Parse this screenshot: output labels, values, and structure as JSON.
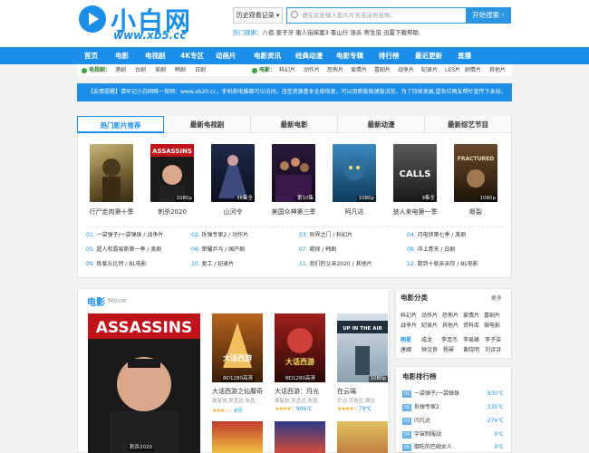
{
  "header": {
    "logo_text": "小白网",
    "logo_url": "www.xb5.cc",
    "history_label": "历史观看记录 ▾",
    "search_placeholder": "请在此处输入影片片名或演员名称。",
    "search_button": "开始搜索 ›",
    "hot_label": "热门搜索：",
    "hot_terms": "八佰  姜子牙  唐人街探案3  晋山行  误杀  寄生虫  迅雷下载帮助"
  },
  "nav": [
    "首页",
    "电影",
    "电视剧",
    "4K专区",
    "动画片",
    "电影资讯",
    "经典动漫",
    "电影专辑",
    "排行榜",
    "最近更新",
    "直播"
  ],
  "subcat": {
    "tv_label": "电视剧：",
    "tv_items": [
      "港剧",
      "台剧",
      "美剧",
      "韩剧",
      "日剧"
    ],
    "movie_label": "电影：",
    "movie_items": [
      "科幻片",
      "动作片",
      "恐怖片",
      "爱情片",
      "喜剧片",
      "战争片",
      "纪录片",
      "LES片",
      "剧情片",
      "其他片"
    ]
  },
  "notice": "【友情提醒】请牢记小白网唯一官网：www.xb20.cc，手机和电脑都可以访问。违签资源基本全部恢复，可以用新版极速版流览，为了持续发展,望各位网友帮忙宣传下本站。",
  "tabs": [
    "热门影片推荐",
    "最新电视剧",
    "最新电影",
    "最新动漫",
    "最新综艺节目"
  ],
  "hot_movies": [
    {
      "title": "行尸走肉第十季",
      "label": ""
    },
    {
      "title": "刺杀2020",
      "label": "1080p"
    },
    {
      "title": "山河令",
      "label": "36集全"
    },
    {
      "title": "美国众神第三季",
      "label": "第10集"
    },
    {
      "title": "阿凡达",
      "label": "1080p"
    },
    {
      "title": "骇人来电第一季",
      "label": "9集全"
    },
    {
      "title": "断裂",
      "label": "1080p"
    }
  ],
  "rank_list": [
    [
      "01.",
      "一袋弹子/一袋弹珠 / 战争片"
    ],
    [
      "02.",
      "拆弹专家2 / 动作片"
    ],
    [
      "03.",
      "异界之门 / 科幻片"
    ],
    [
      "04.",
      "闪电侠第七季 / 美剧"
    ],
    [
      "05.",
      "超人和露易斯第一季 / 美剧"
    ],
    [
      "06.",
      "荣耀乒乓 / 国产剧"
    ],
    [
      "07.",
      "窥探 / 韩剧"
    ],
    [
      "08.",
      "冲上青天 / 日剧"
    ],
    [
      "09.",
      "炼爱丘比特 / BL电影"
    ],
    [
      "10.",
      "复工 / 纪录片"
    ],
    [
      "11.",
      "我们的父亲2020 / 其他片"
    ],
    [
      "12.",
      "数到十就亲亲你 / BL电影"
    ]
  ],
  "movie_section": {
    "title": "电影",
    "subtitle": "Movie",
    "featured_label": "刺杀2020",
    "items": [
      {
        "title": "大话西游之仙履奇",
        "actors": "周星驰,吴孟达,朱茵,",
        "rating": "4分",
        "badge": "BD1280高清"
      },
      {
        "title": "大话西游：月光",
        "actors": "周星驰,吴孟达,朱茵,",
        "rating": "906℃",
        "badge": "BD1280高清"
      },
      {
        "title": "在云端",
        "actors": "乔治·克鲁尼,维拉·",
        "rating": "79℃",
        "badge": "1080p"
      }
    ]
  },
  "categories": {
    "title": "电影分类",
    "more": "更多",
    "rows": [
      [
        "科幻片",
        "动作片",
        "恐怖片",
        "爱情片",
        "喜剧片"
      ],
      [
        "战争片",
        "纪录片",
        "其他片",
        "资料库",
        "微电影"
      ]
    ],
    "star_label": "明星",
    "stars": [
      [
        "成龙",
        "李连杰",
        "李易峰",
        "李子柒",
        "杨颖"
      ],
      [
        "唐嫣",
        "钟汉良",
        "杨幂",
        "黄晓明",
        "刘诗诗"
      ]
    ]
  },
  "side_rank": {
    "title": "电影排行榜",
    "items": [
      [
        "01",
        "一袋弹子/一袋弹珠",
        "930℃"
      ],
      [
        "02",
        "拆弹专家2",
        "335℃"
      ],
      [
        "03",
        "闪凡达",
        "276℃"
      ],
      [
        "04",
        "宇宙制服战",
        "0℃"
      ],
      [
        "05",
        "御吃的巴姆女人",
        "0℃"
      ]
    ]
  },
  "colors": {
    "accent": "#1a8ee8",
    "green": "#3aa33a",
    "star": "#f5a623"
  }
}
